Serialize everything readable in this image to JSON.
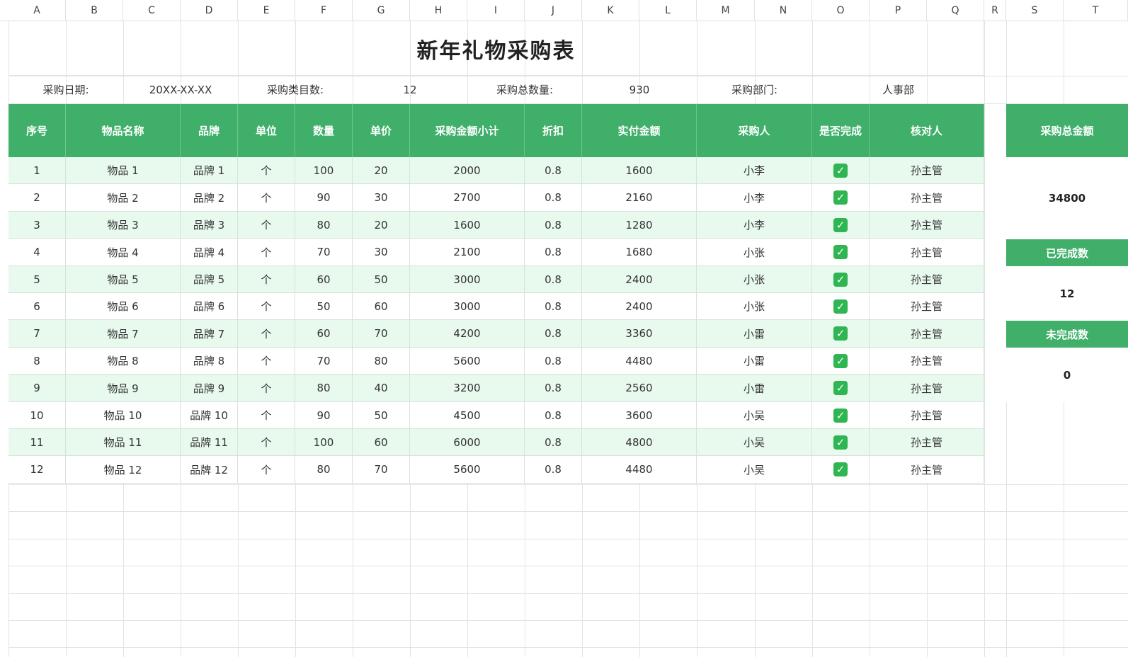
{
  "columns": [
    "A",
    "B",
    "C",
    "D",
    "E",
    "F",
    "G",
    "H",
    "I",
    "J",
    "K",
    "L",
    "M",
    "N",
    "O",
    "P",
    "Q",
    "R",
    "S",
    "T"
  ],
  "title": "新年礼物采购表",
  "info": {
    "date_label": "采购日期:",
    "date_value": "20XX-XX-XX",
    "category_label": "采购类目数:",
    "category_value": "12",
    "total_qty_label": "采购总数量:",
    "total_qty_value": "930",
    "dept_label": "采购部门:",
    "dept_value": "人事部"
  },
  "headers": [
    "序号",
    "物品名称",
    "品牌",
    "单位",
    "数量",
    "单价",
    "采购金额小计",
    "折扣",
    "实付金额",
    "采购人",
    "是否完成",
    "核对人"
  ],
  "rows": [
    [
      "1",
      "物品 1",
      "品牌 1",
      "个",
      "100",
      "20",
      "2000",
      "0.8",
      "1600",
      "小李",
      "✓",
      "孙主管"
    ],
    [
      "2",
      "物品 2",
      "品牌 2",
      "个",
      "90",
      "30",
      "2700",
      "0.8",
      "2160",
      "小李",
      "✓",
      "孙主管"
    ],
    [
      "3",
      "物品 3",
      "品牌 3",
      "个",
      "80",
      "20",
      "1600",
      "0.8",
      "1280",
      "小李",
      "✓",
      "孙主管"
    ],
    [
      "4",
      "物品 4",
      "品牌 4",
      "个",
      "70",
      "30",
      "2100",
      "0.8",
      "1680",
      "小张",
      "✓",
      "孙主管"
    ],
    [
      "5",
      "物品 5",
      "品牌 5",
      "个",
      "60",
      "50",
      "3000",
      "0.8",
      "2400",
      "小张",
      "✓",
      "孙主管"
    ],
    [
      "6",
      "物品 6",
      "品牌 6",
      "个",
      "50",
      "60",
      "3000",
      "0.8",
      "2400",
      "小张",
      "✓",
      "孙主管"
    ],
    [
      "7",
      "物品 7",
      "品牌 7",
      "个",
      "60",
      "70",
      "4200",
      "0.8",
      "3360",
      "小雷",
      "✓",
      "孙主管"
    ],
    [
      "8",
      "物品 8",
      "品牌 8",
      "个",
      "70",
      "80",
      "5600",
      "0.8",
      "4480",
      "小雷",
      "✓",
      "孙主管"
    ],
    [
      "9",
      "物品 9",
      "品牌 9",
      "个",
      "80",
      "40",
      "3200",
      "0.8",
      "2560",
      "小雷",
      "✓",
      "孙主管"
    ],
    [
      "10",
      "物品 10",
      "品牌 10",
      "个",
      "90",
      "50",
      "4500",
      "0.8",
      "3600",
      "小吴",
      "✓",
      "孙主管"
    ],
    [
      "11",
      "物品 11",
      "品牌 11",
      "个",
      "100",
      "60",
      "6000",
      "0.8",
      "4800",
      "小吴",
      "✓",
      "孙主管"
    ],
    [
      "12",
      "物品 12",
      "品牌 12",
      "个",
      "80",
      "70",
      "5600",
      "0.8",
      "4480",
      "小吴",
      "✓",
      "孙主管"
    ]
  ],
  "summary": {
    "total_amount_label": "采购总金额",
    "total_amount_value": "34800",
    "completed_label": "已完成数",
    "completed_value": "12",
    "incomplete_label": "未完成数",
    "incomplete_value": "0"
  },
  "colors": {
    "header_green": "#3faf6a",
    "row_tint": "#e8f9ee",
    "check_green": "#2fb552"
  },
  "icons": {
    "done": "checkbox-checked-icon"
  }
}
